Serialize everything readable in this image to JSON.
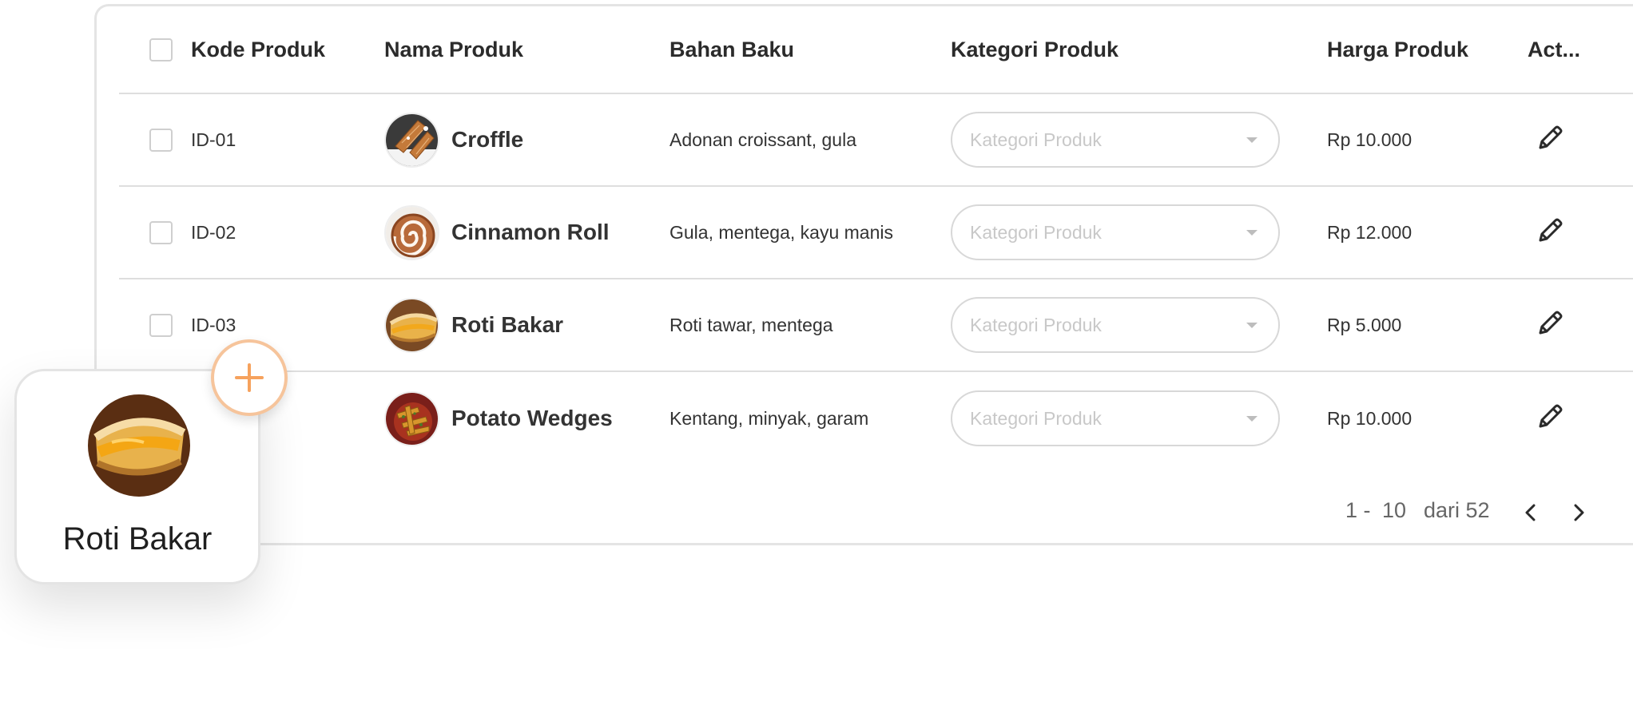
{
  "table": {
    "columns": {
      "code": "Kode Produk",
      "name": "Nama Produk",
      "material": "Bahan Baku",
      "category": "Kategori Produk",
      "price": "Harga Produk",
      "action": "Act..."
    },
    "rows": [
      {
        "code": "ID-01",
        "name": "Croffle",
        "material": "Adonan croissant, gula",
        "category_placeholder": "Kategori Produk",
        "price": "Rp 10.000"
      },
      {
        "code": "ID-02",
        "name": "Cinnamon Roll",
        "material": "Gula, mentega, kayu manis",
        "category_placeholder": "Kategori Produk",
        "price": "Rp 12.000"
      },
      {
        "code": "ID-03",
        "name": "Roti Bakar",
        "material": "Roti tawar, mentega",
        "category_placeholder": "Kategori Produk",
        "price": "Rp 5.000"
      },
      {
        "name": "Potato Wedges",
        "material": "Kentang, minyak, garam",
        "category_placeholder": "Kategori Produk",
        "price": "Rp 10.000"
      }
    ]
  },
  "pagination": {
    "range_start": "1 -",
    "range_end": "10",
    "total": "dari 52",
    "prev_icon": "chevron-left-icon",
    "next_icon": "chevron-right-icon"
  },
  "floating_card": {
    "name": "Roti Bakar",
    "add_icon": "plus-icon"
  },
  "colors": {
    "accent": "#f6a25d",
    "accent_border": "#f6c49b",
    "border": "#e4e4e4",
    "placeholder": "#c8c8c8"
  }
}
